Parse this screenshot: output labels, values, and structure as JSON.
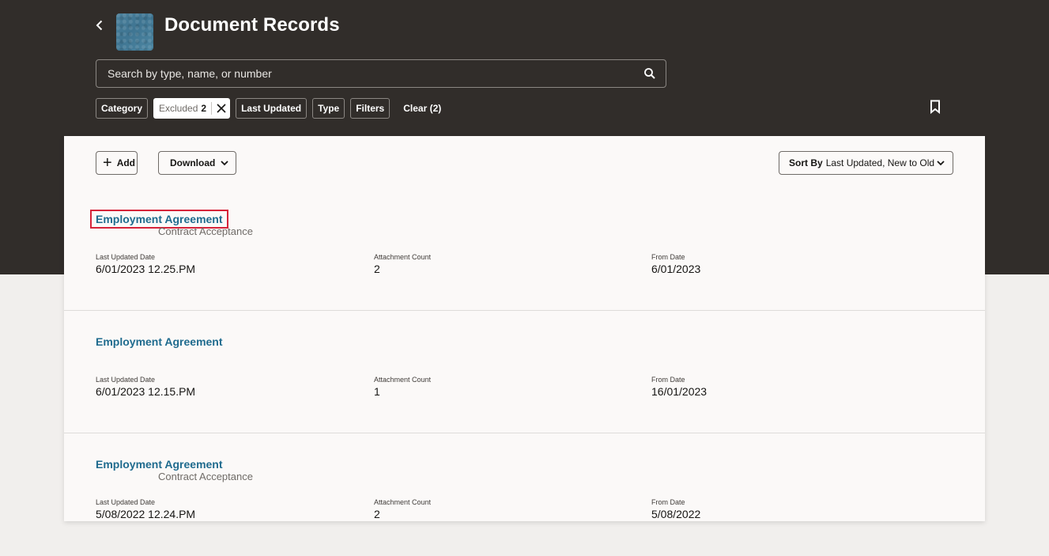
{
  "header": {
    "title": "Document Records",
    "back_icon": "chevron-left-icon"
  },
  "search": {
    "placeholder": "Search by type, name, or number",
    "value": ""
  },
  "filters": {
    "category": "Category",
    "excluded_label": "Excluded",
    "excluded_count": "2",
    "last_updated": "Last Updated",
    "type": "Type",
    "filters": "Filters",
    "clear": "Clear (2)"
  },
  "toolbar": {
    "add_label": "Add",
    "download_label": "Download",
    "sort_label": "Sort By",
    "sort_value": "Last Updated, New to Old"
  },
  "records": [
    {
      "title": "Employment Agreement",
      "subtitle": "Contract Acceptance",
      "last_updated_label": "Last Updated Date",
      "last_updated": "6/01/2023 12.25.PM",
      "attachment_label": "Attachment Count",
      "attachment_count": "2",
      "from_label": "From Date",
      "from_date": "6/01/2023"
    },
    {
      "title": "Employment Agreement",
      "subtitle": "",
      "last_updated_label": "Last Updated Date",
      "last_updated": "6/01/2023 12.15.PM",
      "attachment_label": "Attachment Count",
      "attachment_count": "1",
      "from_label": "From Date",
      "from_date": "16/01/2023"
    },
    {
      "title": "Employment Agreement",
      "subtitle": "Contract Acceptance",
      "last_updated_label": "Last Updated Date",
      "last_updated": "5/08/2022 12.24.PM",
      "attachment_label": "Attachment Count",
      "attachment_count": "2",
      "from_label": "From Date",
      "from_date": "5/08/2022"
    }
  ],
  "colors": {
    "header_bg": "#312d2a",
    "link": "#1f6b8e",
    "highlight_border": "#d6243a"
  }
}
